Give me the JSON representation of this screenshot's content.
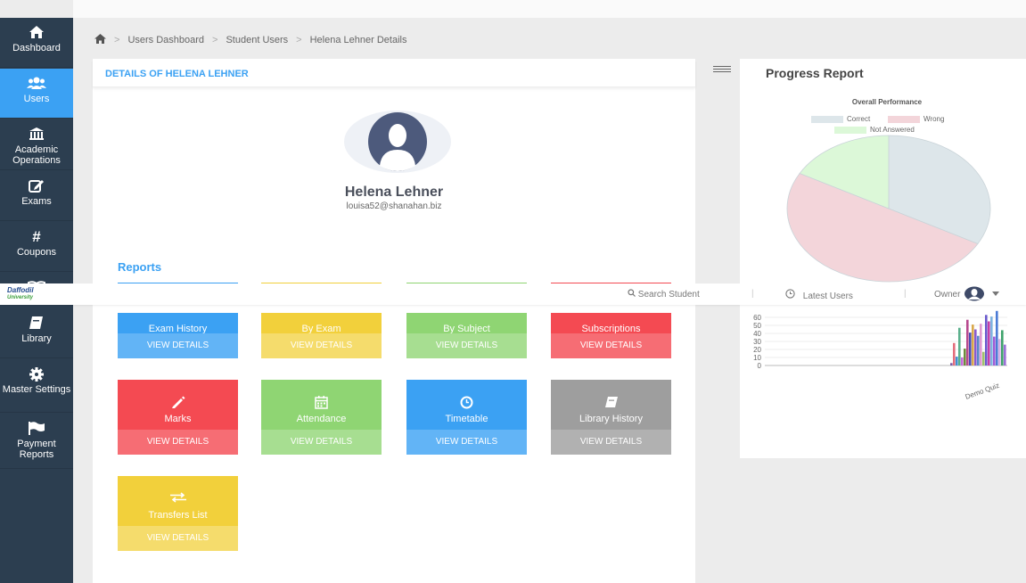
{
  "sidebar": {
    "items": [
      {
        "label": "Dashboard",
        "icon": "home-icon"
      },
      {
        "label": "Users",
        "icon": "users-icon"
      },
      {
        "label": "Academic Operations",
        "icon": "institution-icon"
      },
      {
        "label": "Exams",
        "icon": "edit-icon"
      },
      {
        "label": "Coupons",
        "icon": "hash-icon"
      },
      {
        "label": "Library",
        "icon": "book-icon"
      },
      {
        "label": "Master Settings",
        "icon": "gear-icon"
      },
      {
        "label": "Payment Reports",
        "icon": "flag-icon"
      }
    ]
  },
  "breadcrumb": [
    "Users Dashboard",
    "Student Users",
    "Helena Lehner Details"
  ],
  "details": {
    "heading": "DETAILS OF HELENA LEHNER",
    "name": "Helena Lehner",
    "email": "louisa52@shanahan.biz",
    "reports_title": "Reports"
  },
  "tiles": [
    {
      "label": "Exam History",
      "button": "VIEW DETAILS",
      "color": "#3ba1f3",
      "btn_color": "#62b4f6",
      "icon": "history-icon"
    },
    {
      "label": "By Exam",
      "button": "VIEW DETAILS",
      "color": "#f2d03b",
      "btn_color": "#f5dc6c",
      "icon": "flag-icon"
    },
    {
      "label": "By Subject",
      "button": "VIEW DETAILS",
      "color": "#8fd573",
      "btn_color": "#a7de91",
      "icon": "key-icon"
    },
    {
      "label": "Subscriptions",
      "button": "VIEW DETAILS",
      "color": "#f44a52",
      "btn_color": "#f66d74",
      "icon": "card-icon"
    },
    {
      "label": "Marks",
      "button": "VIEW DETAILS",
      "color": "#f44a52",
      "btn_color": "#f66d74",
      "icon": "pencil-icon"
    },
    {
      "label": "Attendance",
      "button": "VIEW DETAILS",
      "color": "#8fd573",
      "btn_color": "#a7de91",
      "icon": "calendar-icon"
    },
    {
      "label": "Timetable",
      "button": "VIEW DETAILS",
      "color": "#3ba1f3",
      "btn_color": "#62b4f6",
      "icon": "clock-icon"
    },
    {
      "label": "Library History",
      "button": "VIEW DETAILS",
      "color": "#9e9e9e",
      "btn_color": "#b1b1b1",
      "icon": "book-icon"
    },
    {
      "label": "Transfers List",
      "button": "VIEW DETAILS",
      "color": "#f2d03b",
      "btn_color": "#f5dc6c",
      "icon": "transfer-icon"
    }
  ],
  "topbar": {
    "logo_line1": "Daffodil",
    "logo_line2": "University",
    "search": "Search Student",
    "latest": "Latest Users",
    "owner": "Owner"
  },
  "progress": {
    "title": "Progress Report"
  },
  "chart_data": [
    {
      "type": "pie",
      "title": "Overall Performance",
      "labels": [
        "Correct",
        "Wrong",
        "Not Answered"
      ],
      "values": [
        33,
        50,
        17
      ],
      "colors": [
        "#dde6ea",
        "#f3d5da",
        "#dcf8d8"
      ]
    },
    {
      "type": "bar",
      "categories": [
        "Demo Quiz"
      ],
      "ylim": [
        0,
        70
      ],
      "yticks": [
        "0",
        "10",
        "20",
        "30",
        "40",
        "50",
        "60"
      ],
      "series": [
        {
          "values": [
            3
          ]
        },
        {
          "values": [
            28
          ]
        },
        {
          "values": [
            11
          ]
        },
        {
          "values": [
            47
          ]
        },
        {
          "values": [
            10
          ]
        },
        {
          "values": [
            21
          ]
        },
        {
          "values": [
            57
          ]
        },
        {
          "values": [
            41
          ]
        },
        {
          "values": [
            51
          ]
        },
        {
          "values": [
            45
          ]
        },
        {
          "values": [
            37
          ]
        },
        {
          "values": [
            52
          ]
        },
        {
          "values": [
            17
          ]
        },
        {
          "values": [
            63
          ]
        },
        {
          "values": [
            55
          ]
        },
        {
          "values": [
            61
          ]
        },
        {
          "values": [
            36
          ]
        },
        {
          "values": [
            68
          ]
        },
        {
          "values": [
            33
          ]
        },
        {
          "values": [
            44
          ]
        },
        {
          "values": [
            26
          ]
        }
      ],
      "bar_colors": [
        "#7d5ba6",
        "#e36d7c",
        "#3f8fd2",
        "#5bb08c",
        "#c86bd9",
        "#6d8c3c",
        "#b84a8f",
        "#4a4fb5",
        "#d9a84a",
        "#8a5bd0",
        "#5a86c9",
        "#e09ad0",
        "#9ec36a",
        "#6a5acd",
        "#c33ea8",
        "#7fb3e0",
        "#a25bd6",
        "#4b7bd6",
        "#d8b0e8",
        "#3fa36c",
        "#9b6fd6"
      ]
    }
  ]
}
